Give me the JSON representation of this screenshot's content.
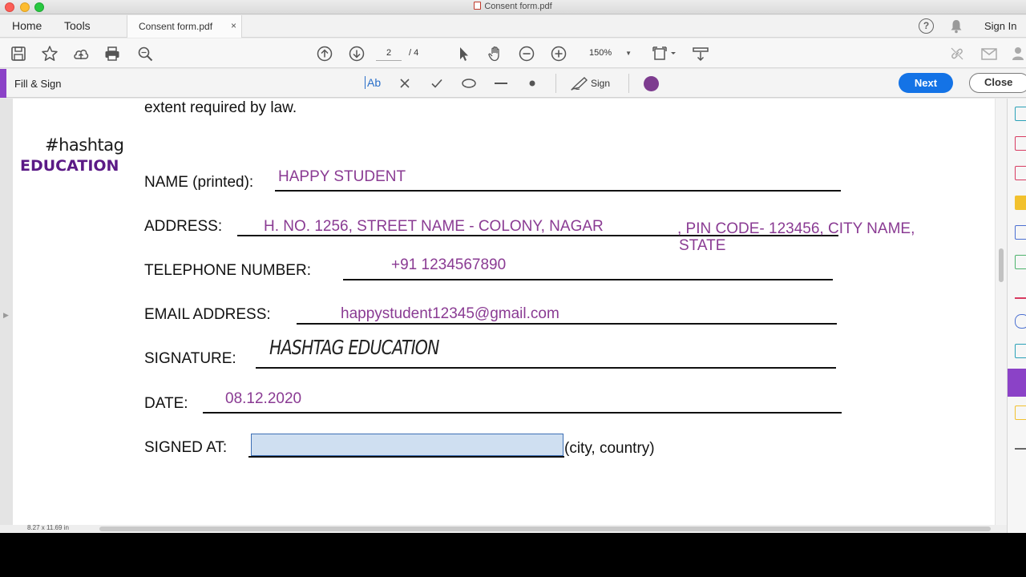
{
  "window": {
    "title": "Consent form.pdf"
  },
  "tabs": {
    "home": "Home",
    "tools": "Tools",
    "doc_tab": "Consent form.pdf",
    "close_glyph": "×",
    "sign_in": "Sign In"
  },
  "toolbar": {
    "page_current": "2",
    "page_total": "/ 4",
    "zoom": "150%"
  },
  "fill_sign": {
    "title": "Fill & Sign",
    "text_tool": "Ab",
    "sign_label": "Sign",
    "next": "Next",
    "close": "Close",
    "color": "#7d3c8f"
  },
  "document": {
    "header_text": "extent required by law.",
    "logo_line1": "#hashtag",
    "logo_line2": "EDUCATION",
    "fields": {
      "name_label": "NAME (printed):",
      "name_value": "HAPPY STUDENT",
      "address_label": "ADDRESS:",
      "address_value_1": "H. NO. 1256, STREET NAME - COLONY, NAGAR",
      "address_value_2": ", PIN CODE- 123456, CITY NAME,",
      "address_value_3": "STATE",
      "telephone_label": "TELEPHONE NUMBER:",
      "telephone_value": "+91 1234567890",
      "email_label": "EMAIL ADDRESS:",
      "email_value": "happystudent12345@gmail.com",
      "signature_label": "SIGNATURE:",
      "signature_value": "HASHTAG EDUCATION",
      "date_label": "DATE:",
      "date_value": "08.12.2020",
      "signed_at_label": "SIGNED AT:",
      "signed_at_suffix": "(city, country)",
      "signed_at_value": ""
    }
  },
  "status": {
    "page_size": "8.27 x 11.69 in"
  }
}
